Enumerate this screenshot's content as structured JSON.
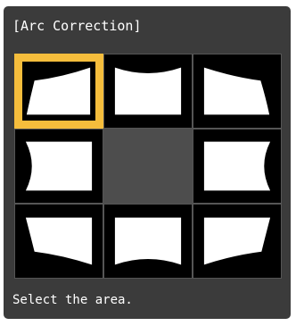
{
  "panel": {
    "title": "[Arc Correction]",
    "status": "Select the area."
  },
  "colors": {
    "panel_bg": "#3b3b3b",
    "selected": "#f5bd3c"
  },
  "grid": {
    "cells": [
      {
        "name": "area-top-left",
        "icon": "corner-top-left-arc-icon",
        "selected": true
      },
      {
        "name": "area-top-center",
        "icon": "edge-top-arc-icon",
        "selected": false
      },
      {
        "name": "area-top-right",
        "icon": "corner-top-right-arc-icon",
        "selected": false
      },
      {
        "name": "area-middle-left",
        "icon": "edge-left-arc-icon",
        "selected": false
      },
      {
        "name": "area-center",
        "icon": "",
        "selected": false
      },
      {
        "name": "area-middle-right",
        "icon": "edge-right-arc-icon",
        "selected": false
      },
      {
        "name": "area-bottom-left",
        "icon": "corner-bottom-left-arc-icon",
        "selected": false
      },
      {
        "name": "area-bottom-center",
        "icon": "edge-bottom-arc-icon",
        "selected": false
      },
      {
        "name": "area-bottom-right",
        "icon": "corner-bottom-right-arc-icon",
        "selected": false
      }
    ]
  }
}
